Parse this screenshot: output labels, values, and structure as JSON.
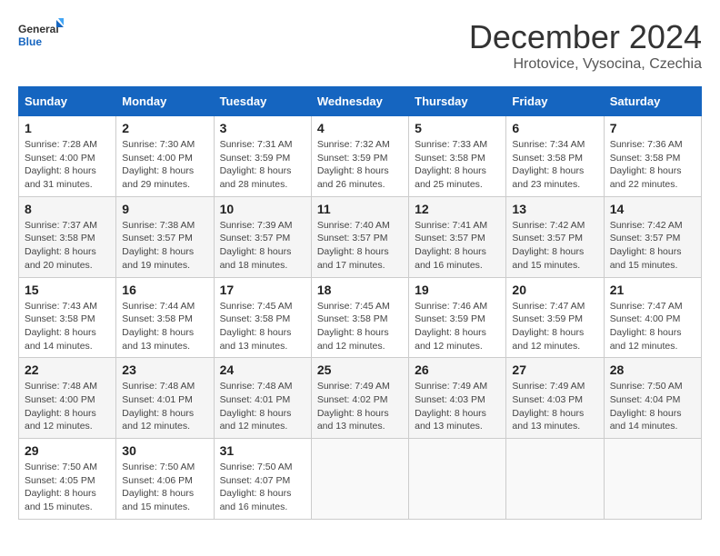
{
  "logo": {
    "line1": "General",
    "line2": "Blue"
  },
  "title": "December 2024",
  "subtitle": "Hrotovice, Vysocina, Czechia",
  "days_of_week": [
    "Sunday",
    "Monday",
    "Tuesday",
    "Wednesday",
    "Thursday",
    "Friday",
    "Saturday"
  ],
  "weeks": [
    [
      {
        "day": 1,
        "sunrise": "7:28 AM",
        "sunset": "4:00 PM",
        "daylight": "8 hours and 31 minutes."
      },
      {
        "day": 2,
        "sunrise": "7:30 AM",
        "sunset": "4:00 PM",
        "daylight": "8 hours and 29 minutes."
      },
      {
        "day": 3,
        "sunrise": "7:31 AM",
        "sunset": "3:59 PM",
        "daylight": "8 hours and 28 minutes."
      },
      {
        "day": 4,
        "sunrise": "7:32 AM",
        "sunset": "3:59 PM",
        "daylight": "8 hours and 26 minutes."
      },
      {
        "day": 5,
        "sunrise": "7:33 AM",
        "sunset": "3:58 PM",
        "daylight": "8 hours and 25 minutes."
      },
      {
        "day": 6,
        "sunrise": "7:34 AM",
        "sunset": "3:58 PM",
        "daylight": "8 hours and 23 minutes."
      },
      {
        "day": 7,
        "sunrise": "7:36 AM",
        "sunset": "3:58 PM",
        "daylight": "8 hours and 22 minutes."
      }
    ],
    [
      {
        "day": 8,
        "sunrise": "7:37 AM",
        "sunset": "3:58 PM",
        "daylight": "8 hours and 20 minutes."
      },
      {
        "day": 9,
        "sunrise": "7:38 AM",
        "sunset": "3:57 PM",
        "daylight": "8 hours and 19 minutes."
      },
      {
        "day": 10,
        "sunrise": "7:39 AM",
        "sunset": "3:57 PM",
        "daylight": "8 hours and 18 minutes."
      },
      {
        "day": 11,
        "sunrise": "7:40 AM",
        "sunset": "3:57 PM",
        "daylight": "8 hours and 17 minutes."
      },
      {
        "day": 12,
        "sunrise": "7:41 AM",
        "sunset": "3:57 PM",
        "daylight": "8 hours and 16 minutes."
      },
      {
        "day": 13,
        "sunrise": "7:42 AM",
        "sunset": "3:57 PM",
        "daylight": "8 hours and 15 minutes."
      },
      {
        "day": 14,
        "sunrise": "7:42 AM",
        "sunset": "3:57 PM",
        "daylight": "8 hours and 15 minutes."
      }
    ],
    [
      {
        "day": 15,
        "sunrise": "7:43 AM",
        "sunset": "3:58 PM",
        "daylight": "8 hours and 14 minutes."
      },
      {
        "day": 16,
        "sunrise": "7:44 AM",
        "sunset": "3:58 PM",
        "daylight": "8 hours and 13 minutes."
      },
      {
        "day": 17,
        "sunrise": "7:45 AM",
        "sunset": "3:58 PM",
        "daylight": "8 hours and 13 minutes."
      },
      {
        "day": 18,
        "sunrise": "7:45 AM",
        "sunset": "3:58 PM",
        "daylight": "8 hours and 12 minutes."
      },
      {
        "day": 19,
        "sunrise": "7:46 AM",
        "sunset": "3:59 PM",
        "daylight": "8 hours and 12 minutes."
      },
      {
        "day": 20,
        "sunrise": "7:47 AM",
        "sunset": "3:59 PM",
        "daylight": "8 hours and 12 minutes."
      },
      {
        "day": 21,
        "sunrise": "7:47 AM",
        "sunset": "4:00 PM",
        "daylight": "8 hours and 12 minutes."
      }
    ],
    [
      {
        "day": 22,
        "sunrise": "7:48 AM",
        "sunset": "4:00 PM",
        "daylight": "8 hours and 12 minutes."
      },
      {
        "day": 23,
        "sunrise": "7:48 AM",
        "sunset": "4:01 PM",
        "daylight": "8 hours and 12 minutes."
      },
      {
        "day": 24,
        "sunrise": "7:48 AM",
        "sunset": "4:01 PM",
        "daylight": "8 hours and 12 minutes."
      },
      {
        "day": 25,
        "sunrise": "7:49 AM",
        "sunset": "4:02 PM",
        "daylight": "8 hours and 13 minutes."
      },
      {
        "day": 26,
        "sunrise": "7:49 AM",
        "sunset": "4:03 PM",
        "daylight": "8 hours and 13 minutes."
      },
      {
        "day": 27,
        "sunrise": "7:49 AM",
        "sunset": "4:03 PM",
        "daylight": "8 hours and 13 minutes."
      },
      {
        "day": 28,
        "sunrise": "7:50 AM",
        "sunset": "4:04 PM",
        "daylight": "8 hours and 14 minutes."
      }
    ],
    [
      {
        "day": 29,
        "sunrise": "7:50 AM",
        "sunset": "4:05 PM",
        "daylight": "8 hours and 15 minutes."
      },
      {
        "day": 30,
        "sunrise": "7:50 AM",
        "sunset": "4:06 PM",
        "daylight": "8 hours and 15 minutes."
      },
      {
        "day": 31,
        "sunrise": "7:50 AM",
        "sunset": "4:07 PM",
        "daylight": "8 hours and 16 minutes."
      },
      null,
      null,
      null,
      null
    ]
  ]
}
